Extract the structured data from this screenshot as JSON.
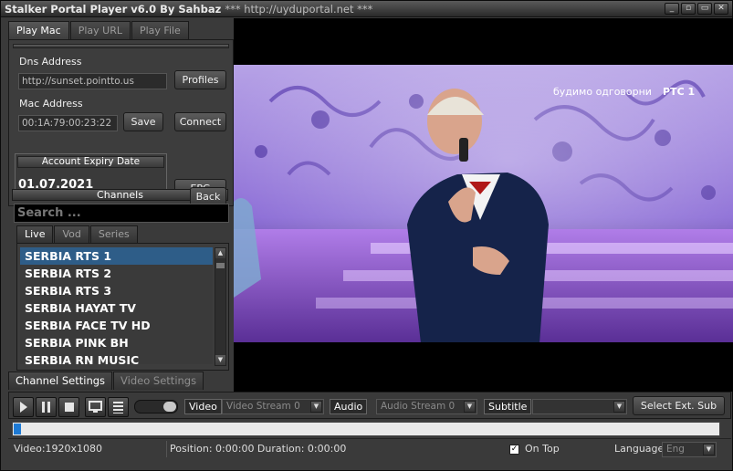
{
  "window": {
    "title": "Stalker Portal Player v6.0 By Sahbaz",
    "subtitle": "*** http://uyduportal.net ***",
    "buttons": [
      "_",
      "▫",
      "▭",
      "✕"
    ]
  },
  "left": {
    "tabs": [
      "Play Mac",
      "Play URL",
      "Play File"
    ],
    "dns_label": "Dns Address",
    "dns_value": "http://sunset.pointto.us",
    "profiles_button": "Profiles",
    "mac_label": "Mac Address",
    "mac_value": "00:1A:79:00:23:22",
    "save_button": "Save",
    "connect_button": "Connect",
    "expiry_label": "Account Expiry Date",
    "expiry_value": "01.07.2021",
    "epg_button": "EPG",
    "channels_label": "Channels",
    "back_button": "Back",
    "search_placeholder": "Search ...",
    "list_tabs": [
      "Live",
      "Vod",
      "Series"
    ],
    "channels": [
      "SERBIA RTS 1",
      "SERBIA RTS 2",
      "SERBIA RTS 3",
      "SERBIA HAYAT TV",
      "SERBIA FACE TV HD",
      "SERBIA PINK BH",
      "SERBIA RN MUSIC"
    ],
    "selected_channel": 0
  },
  "settings_tabs": [
    "Channel Settings",
    "Video Settings"
  ],
  "video": {
    "overlay_text": "будимо одговорни",
    "channel_logo": "РТС 1"
  },
  "controls": {
    "video_label": "Video",
    "video_stream": "Video Stream 0",
    "audio_label": "Audio",
    "audio_stream": "Audio Stream 0",
    "subtitle_label": "Subtitle",
    "subtitle_value": "",
    "select_sub_button": "Select Ext. Sub",
    "volume_level": 1.0,
    "progress": 0.01
  },
  "status": {
    "video_info": "Video:1920x1080",
    "position": "Position: 0:00:00 Duration: 0:00:00",
    "on_top_label": "On Top",
    "on_top_checked": true,
    "language_label": "Language",
    "language_value": "Eng"
  },
  "colors": {
    "accent": "#2e5d88",
    "progress": "#1e7ad4"
  }
}
